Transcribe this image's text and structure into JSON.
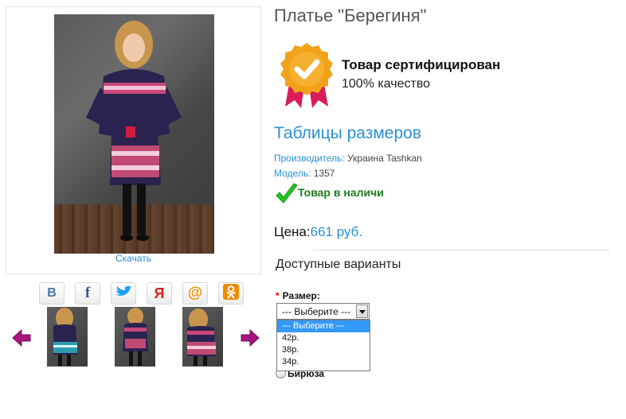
{
  "product": {
    "title": "Платье \"Берегиня\"",
    "download_label": "Скачать",
    "certificate": {
      "title": "Товар сертифицирован",
      "subtitle": "100% качество"
    },
    "size_table_link": "Таблицы размеров",
    "manufacturer": {
      "label": "Производитель:",
      "value": " Украина Tashkan"
    },
    "model": {
      "label": "Модель:",
      "value": " 1357"
    },
    "stock_status": "Товар в наличи",
    "price": {
      "label": "Цена:",
      "value": "661 руб."
    },
    "variants": {
      "title": "Доступные варианты",
      "size": {
        "required_mark": "*",
        "label": "Размер:",
        "selected": "--- Выберите ---",
        "options": [
          "--- Выберите ---",
          "42р.",
          "38р.",
          "34р."
        ]
      },
      "color_option": "Бирюза"
    }
  },
  "social": [
    {
      "icon": "vk-icon",
      "glyph": "B",
      "color": "#4a76a8"
    },
    {
      "icon": "facebook-icon",
      "glyph": "f",
      "color": "#3b5998"
    },
    {
      "icon": "twitter-icon",
      "glyph": "🐦",
      "color": "#1da1f2"
    },
    {
      "icon": "yandex-icon",
      "glyph": "Я",
      "color": "#e02020"
    },
    {
      "icon": "mail-icon",
      "glyph": "@",
      "color": "#f39200"
    },
    {
      "icon": "odnoklassniki-icon",
      "glyph": "ок",
      "color": "#f28b00"
    }
  ],
  "colors": {
    "accent": "#2a8fd4",
    "stock_green": "#1d7a1d",
    "arrow_magenta": "#a8157e",
    "badge_gold": "#f2a21a",
    "badge_ribbon": "#d81c5a"
  }
}
